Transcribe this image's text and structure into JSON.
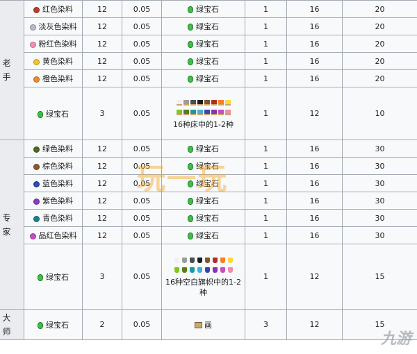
{
  "groups": {
    "novice": {
      "label": "老手"
    },
    "expert": {
      "label": "专家"
    },
    "master": {
      "label": "大师"
    }
  },
  "rows": [
    {
      "item": "红色染料",
      "color": "#c0392b",
      "qty": "12",
      "mult": "0.05",
      "price": "绿宝石",
      "pcount": "1",
      "max": "16",
      "xp": "20"
    },
    {
      "item": "淡灰色染料",
      "color": "#b8b8c8",
      "qty": "12",
      "mult": "0.05",
      "price": "绿宝石",
      "pcount": "1",
      "max": "16",
      "xp": "20"
    },
    {
      "item": "粉红色染料",
      "color": "#f18fb9",
      "qty": "12",
      "mult": "0.05",
      "price": "绿宝石",
      "pcount": "1",
      "max": "16",
      "xp": "20"
    },
    {
      "item": "黄色染料",
      "color": "#f4c430",
      "qty": "12",
      "mult": "0.05",
      "price": "绿宝石",
      "pcount": "1",
      "max": "16",
      "xp": "20"
    },
    {
      "item": "橙色染料",
      "color": "#f0892a",
      "qty": "12",
      "mult": "0.05",
      "price": "绿宝石",
      "pcount": "1",
      "max": "16",
      "xp": "20"
    },
    {
      "item": "绿色染料",
      "color": "#4d6b1f",
      "qty": "12",
      "mult": "0.05",
      "price": "绿宝石",
      "pcount": "1",
      "max": "16",
      "xp": "30"
    },
    {
      "item": "棕色染料",
      "color": "#8b5a2b",
      "qty": "12",
      "mult": "0.05",
      "price": "绿宝石",
      "pcount": "1",
      "max": "16",
      "xp": "30"
    },
    {
      "item": "蓝色染料",
      "color": "#2e4bb8",
      "qty": "12",
      "mult": "0.05",
      "price": "绿宝石",
      "pcount": "1",
      "max": "16",
      "xp": "30"
    },
    {
      "item": "紫色染料",
      "color": "#8e3bc2",
      "qty": "12",
      "mult": "0.05",
      "price": "绿宝石",
      "pcount": "1",
      "max": "16",
      "xp": "30"
    },
    {
      "item": "青色染料",
      "color": "#1d7f8f",
      "qty": "12",
      "mult": "0.05",
      "price": "绿宝石",
      "pcount": "1",
      "max": "16",
      "xp": "30"
    },
    {
      "item": "品红色染料",
      "color": "#c74ec2",
      "qty": "12",
      "mult": "0.05",
      "price": "绿宝石",
      "pcount": "1",
      "max": "16",
      "xp": "30"
    }
  ],
  "bed_row": {
    "item": "绿宝石",
    "qty": "3",
    "mult": "0.05",
    "caption": "16种床中的1-2种",
    "pcount": "1",
    "max": "12",
    "xp": "10"
  },
  "banner_row": {
    "item": "绿宝石",
    "qty": "3",
    "mult": "0.05",
    "caption": "16种空白旗帜中的1-2种",
    "pcount": "1",
    "max": "12",
    "xp": "15"
  },
  "master_row": {
    "item": "绿宝石",
    "qty": "2",
    "mult": "0.05",
    "price": "画",
    "pcount": "3",
    "max": "12",
    "xp": "15"
  },
  "palette": [
    "#f0f0f0",
    "#9d9d97",
    "#474f52",
    "#1d1d21",
    "#835432",
    "#b02e26",
    "#f9801d",
    "#fed83d",
    "#80c71f",
    "#5e7c16",
    "#169c9c",
    "#3ab3da",
    "#3c44aa",
    "#8932b8",
    "#c74ebd",
    "#f38baa"
  ],
  "watermarks": {
    "center": "玩一玩",
    "corner": "九游"
  }
}
